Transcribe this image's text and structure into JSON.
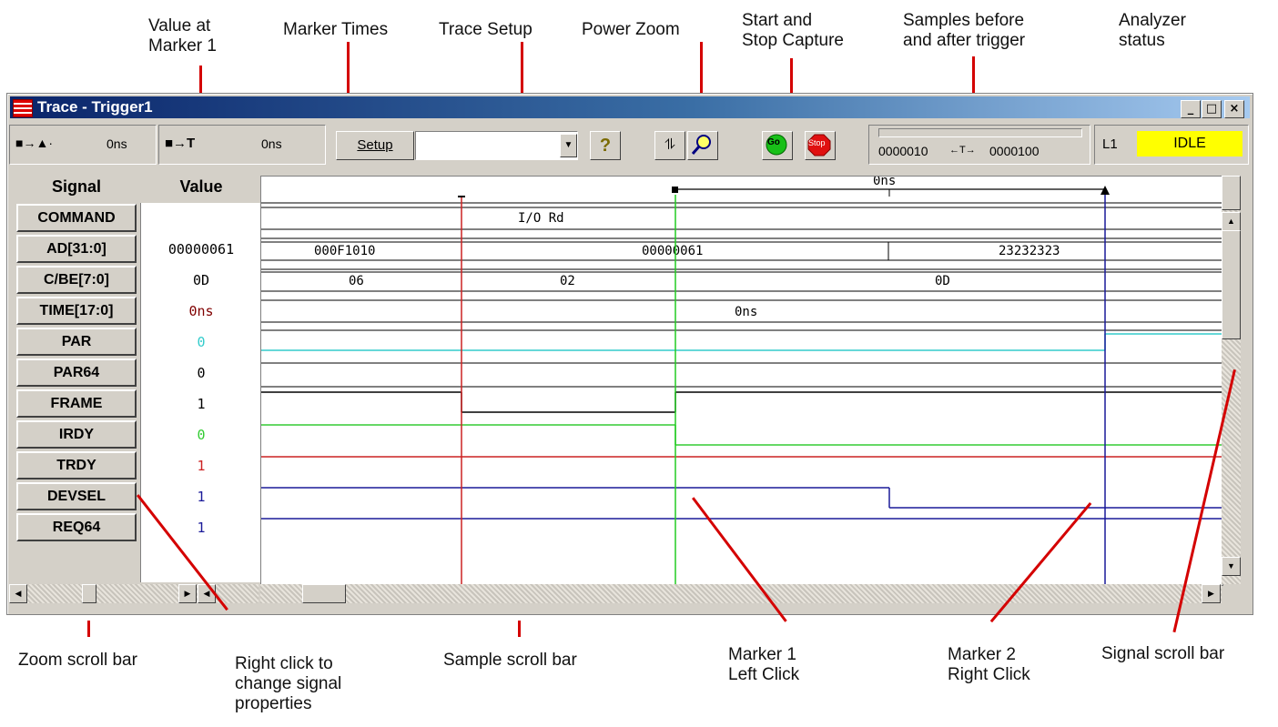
{
  "annotations": {
    "value_at_marker": [
      "Value at",
      "Marker 1"
    ],
    "marker_times": "Marker Times",
    "trace_setup": "Trace Setup",
    "power_zoom": "Power Zoom",
    "start_stop": [
      "Start and",
      "Stop Capture"
    ],
    "samples": [
      "Samples before",
      "and after trigger"
    ],
    "analyzer_status": [
      "Analyzer",
      "status"
    ],
    "zoom_scroll": "Zoom scroll bar",
    "right_click": [
      "Right click to",
      "change signal",
      "properties"
    ],
    "sample_scroll": "Sample scroll bar",
    "marker1": [
      "Marker 1",
      "Left Click"
    ],
    "marker2": [
      "Marker 2",
      "Right Click"
    ],
    "signal_scroll": "Signal scroll bar"
  },
  "window": {
    "title": "Trace - Trigger1",
    "minimize": "_",
    "maximize": "□",
    "close": "×"
  },
  "toolbar": {
    "marker_span_label": "■→▲·",
    "marker_span_value": "0ns",
    "marker_trigger_label": "■→T",
    "marker_trigger_value": "0ns",
    "setup_label": "Setup",
    "help_glyph": "?",
    "go_label": "Go",
    "stop_label": "Stop",
    "samples_before": "0000010",
    "samples_arrow": "←T→",
    "samples_after": "0000100",
    "level": "L1",
    "status": "IDLE"
  },
  "columns": {
    "signal": "Signal",
    "value": "Value"
  },
  "signals": [
    {
      "name": "COMMAND",
      "value": "",
      "color": "#000000"
    },
    {
      "name": "AD[31:0]",
      "value": "00000061",
      "color": "#000000"
    },
    {
      "name": "C/BE[7:0]",
      "value": "0D",
      "color": "#000000"
    },
    {
      "name": "TIME[17:0]",
      "value": "0ns",
      "color": "#800000"
    },
    {
      "name": "PAR",
      "value": "0",
      "color": "#33cccc"
    },
    {
      "name": "PAR64",
      "value": "0",
      "color": "#000000"
    },
    {
      "name": "FRAME",
      "value": "1",
      "color": "#000000"
    },
    {
      "name": "IRDY",
      "value": "0",
      "color": "#33cc33"
    },
    {
      "name": "TRDY",
      "value": "1",
      "color": "#cc2222"
    },
    {
      "name": "DEVSEL",
      "value": "1",
      "color": "#1a1a99"
    },
    {
      "name": "REQ64",
      "value": "1",
      "color": "#1a1a99"
    }
  ],
  "waveform": {
    "ruler_label": "0ns",
    "command_text": "I/O Rd",
    "ad_values": [
      "000F1010",
      "00000061",
      "23232323"
    ],
    "cbe_values": [
      "06",
      "02",
      "0D"
    ],
    "time_text": "0ns"
  }
}
